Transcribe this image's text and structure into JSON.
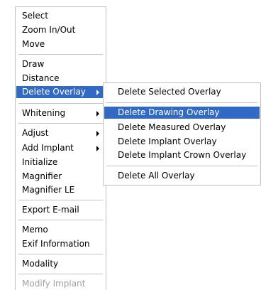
{
  "main_menu": {
    "items": [
      {
        "label": "Select"
      },
      {
        "label": "Zoom In/Out"
      },
      {
        "label": "Move"
      },
      {
        "label": "Draw"
      },
      {
        "label": "Distance"
      },
      {
        "label": "Delete Overlay",
        "state": "highlighted",
        "submenu": true
      },
      {
        "label": "Whitening",
        "submenu": true
      },
      {
        "label": "Adjust",
        "submenu": true
      },
      {
        "label": "Add Implant",
        "submenu": true
      },
      {
        "label": "Initialize"
      },
      {
        "label": "Magnifier"
      },
      {
        "label": "Magnifier LE"
      },
      {
        "label": "Export E-mail"
      },
      {
        "label": "Memo"
      },
      {
        "label": "Exif Information"
      },
      {
        "label": "Modality"
      },
      {
        "label": "Modify Implant",
        "state": "disabled"
      }
    ]
  },
  "sub_menu": {
    "items": [
      {
        "label": "Delete Selected Overlay"
      },
      {
        "label": "Delete Drawing Overlay",
        "state": "highlighted"
      },
      {
        "label": "Delete Measured Overlay"
      },
      {
        "label": "Delete Implant Overlay"
      },
      {
        "label": "Delete Implant Crown Overlay"
      },
      {
        "label": "Delete All Overlay"
      }
    ]
  },
  "colors": {
    "highlight_bg": "#3169c6",
    "highlight_text": "#ffffff",
    "disabled_text": "#a0a0a0",
    "border": "#c0c0c0",
    "separator": "#c4c4c4"
  },
  "icons": {
    "submenu_arrow": "submenu-arrow-icon"
  }
}
